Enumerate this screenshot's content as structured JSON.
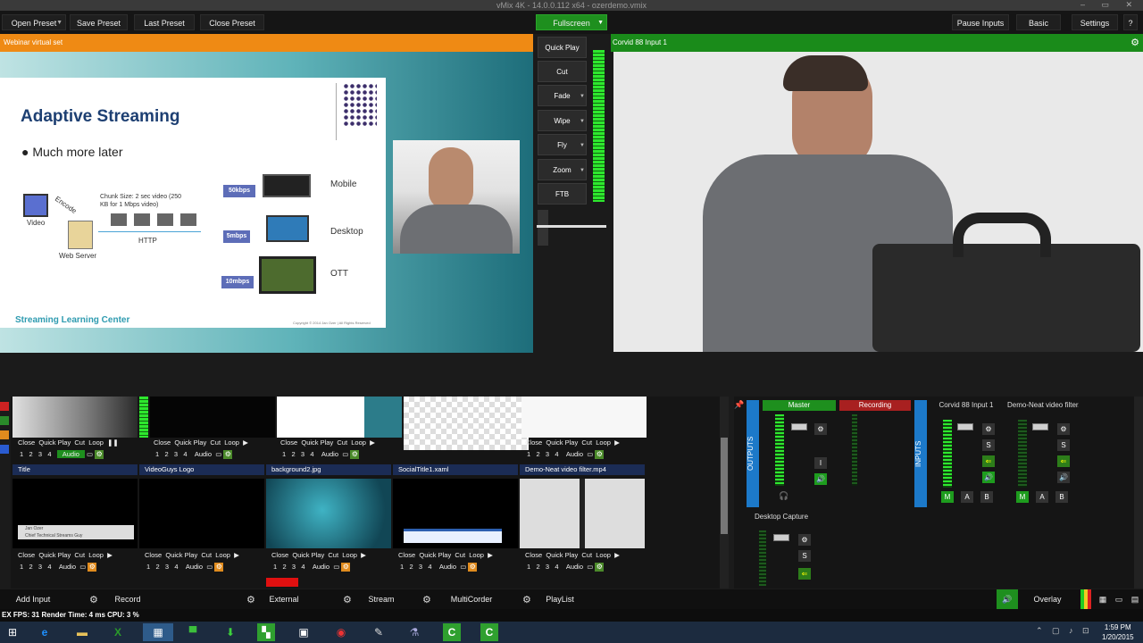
{
  "window": {
    "title": "vMix 4K - 14.0.0.112 x64 - ozerdemo.vmix",
    "controls": "–  ▭  ✕"
  },
  "toolbar": {
    "open_preset": "Open Preset",
    "save_preset": "Save Preset",
    "last_preset": "Last Preset",
    "close_preset": "Close Preset",
    "fullscreen": "Fullscreen",
    "pause_inputs": "Pause Inputs",
    "basic": "Basic",
    "settings": "Settings",
    "help": "?"
  },
  "preview": {
    "title": "Webinar virtual set",
    "slide": {
      "title": "Adaptive Streaming",
      "bullet": "Much more later",
      "chunk_text": "Chunk Size: 2 sec video (250 KB for 1 Mbps video)",
      "encode": "Encode",
      "video": "Video",
      "web_server": "Web Server",
      "http": "HTTP",
      "rates": [
        "50kbps",
        "5mbps",
        "10mbps"
      ],
      "devices": [
        "Mobile",
        "Desktop",
        "OTT"
      ],
      "footer": "Streaming Learning Center",
      "copyright": "Copyright © 2014 Jan Ozer | All Rights Reserved"
    }
  },
  "transitions": {
    "buttons": [
      "Quick Play",
      "Cut",
      "Fade",
      "Wipe",
      "Fly",
      "Zoom",
      "FTB"
    ]
  },
  "output": {
    "title": "Corvid 88 Input 1"
  },
  "input_controls": {
    "close": "Close",
    "quick_play": "Quick Play",
    "cut": "Cut",
    "loop": "Loop",
    "nums": [
      "1",
      "2",
      "3",
      "4"
    ],
    "audio": "Audio"
  },
  "inputs_row2": {
    "names": [
      "Title",
      "VideoGuys Logo",
      "background2.jpg",
      "SocialTitle1.xaml",
      "Demo-Neat video filter.mp4"
    ],
    "title_lower_third": "Jan Ozer",
    "title_lower_third_sub": "Chief Technical Streams Guy"
  },
  "mixer": {
    "outputs": "OUTPUTS",
    "inputs": "INPUTS",
    "master": "Master",
    "recording": "Recording",
    "channels": [
      "Corvid 88 Input 1",
      "Demo-Neat video filter.mp4",
      "Desktop Capture"
    ],
    "m": "M",
    "a": "A",
    "b": "B",
    "s": "S",
    "i": "I"
  },
  "bottom": {
    "add_input": "Add Input",
    "record": "Record",
    "external": "External",
    "stream": "Stream",
    "multicorder": "MultiCorder",
    "playlist": "PlayList",
    "overlay": "Overlay"
  },
  "status": {
    "text": "EX  FPS: 31  Render Time: 4 ms  CPU: 3 %"
  },
  "clock": {
    "time": "1:59 PM",
    "date": "1/20/2015"
  },
  "colors": {
    "preview_orange": "#ef8a14",
    "output_green": "#1a8b1a",
    "accent_blue": "#1c79c9",
    "recording_red": "#a82020"
  }
}
